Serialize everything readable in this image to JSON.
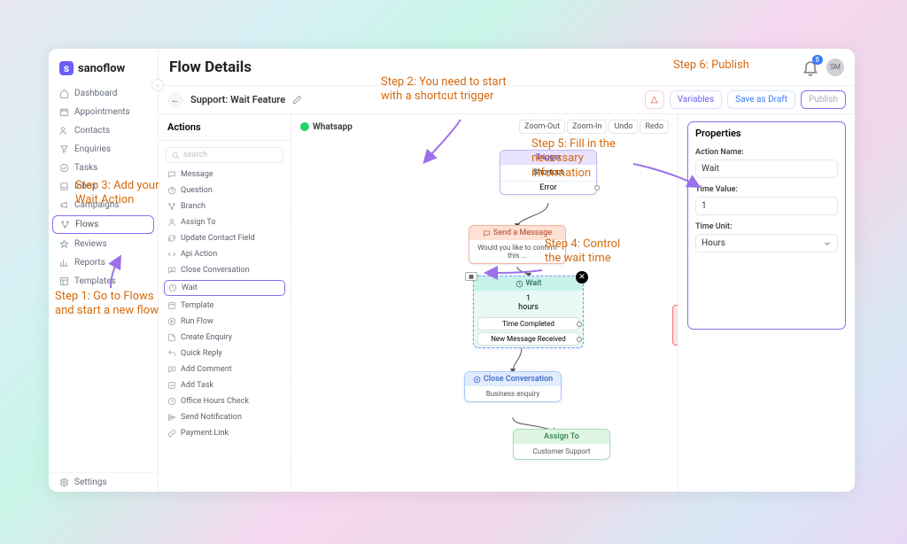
{
  "brand": "sanoflow",
  "nav": {
    "items": [
      {
        "label": "Dashboard",
        "icon": "home"
      },
      {
        "label": "Appointments",
        "icon": "calendar"
      },
      {
        "label": "Contacts",
        "icon": "users"
      },
      {
        "label": "Enquiries",
        "icon": "filter"
      },
      {
        "label": "Tasks",
        "icon": "check"
      },
      {
        "label": "Inbox",
        "icon": "inbox"
      },
      {
        "label": "Campaigns",
        "icon": "megaphone"
      },
      {
        "label": "Flows",
        "icon": "branch"
      },
      {
        "label": "Reviews",
        "icon": "star"
      },
      {
        "label": "Reports",
        "icon": "chart"
      },
      {
        "label": "Templates",
        "icon": "layout"
      }
    ],
    "settings": "Settings"
  },
  "header": {
    "title": "Flow Details",
    "notifications": "8",
    "avatar": "SM"
  },
  "subheader": {
    "flow_name": "Support: Wait Feature",
    "warn_icon": "△",
    "variables": "Variables",
    "save": "Save as Draft",
    "publish": "Publish"
  },
  "actions": {
    "title": "Actions",
    "search_placeholder": "search",
    "items": [
      "Message",
      "Question",
      "Branch",
      "Assign To",
      "Update Contact Field",
      "Api Action",
      "Close Conversation",
      "Wait",
      "Template",
      "Run Flow",
      "Create Enquiry",
      "Quick Reply",
      "Add Comment",
      "Add Task",
      "Office Hours Check",
      "Send Notification",
      "Payment Link"
    ]
  },
  "canvas": {
    "channel": "Whatsapp",
    "controls": [
      "Zoom-Out",
      "Zoom-In",
      "Undo",
      "Redo"
    ],
    "nodes": {
      "trigger": {
        "title": "Trigger",
        "body": "Shortcut",
        "row": "Error"
      },
      "send": {
        "title": "Send a Message",
        "body": "Would you like to confirm this ..."
      },
      "wait": {
        "title": "Wait",
        "value": "1",
        "unit": "hours",
        "row1": "Time Completed",
        "row2": "New Message Received"
      },
      "close": {
        "title": "Close Conversation",
        "body": "Business enquiry"
      },
      "assign": {
        "title": "Assign To",
        "body": "Customer Support"
      }
    }
  },
  "props": {
    "title": "Properties",
    "name_label": "Action Name:",
    "name_value": "Wait",
    "value_label": "Time Value:",
    "value_value": "1",
    "unit_label": "Time Unit:",
    "unit_value": "Hours"
  },
  "annotations": {
    "step1": "Step 1: Go to Flows and start a new flow",
    "step2": "Step 2: You need to start with a shortcut trigger",
    "step3": "Step 3: Add your Wait Action",
    "step4": "Step 4: Control the wait time",
    "step5": "Step 5: Fill in the necessary information",
    "step6": "Step 6: Publish"
  }
}
